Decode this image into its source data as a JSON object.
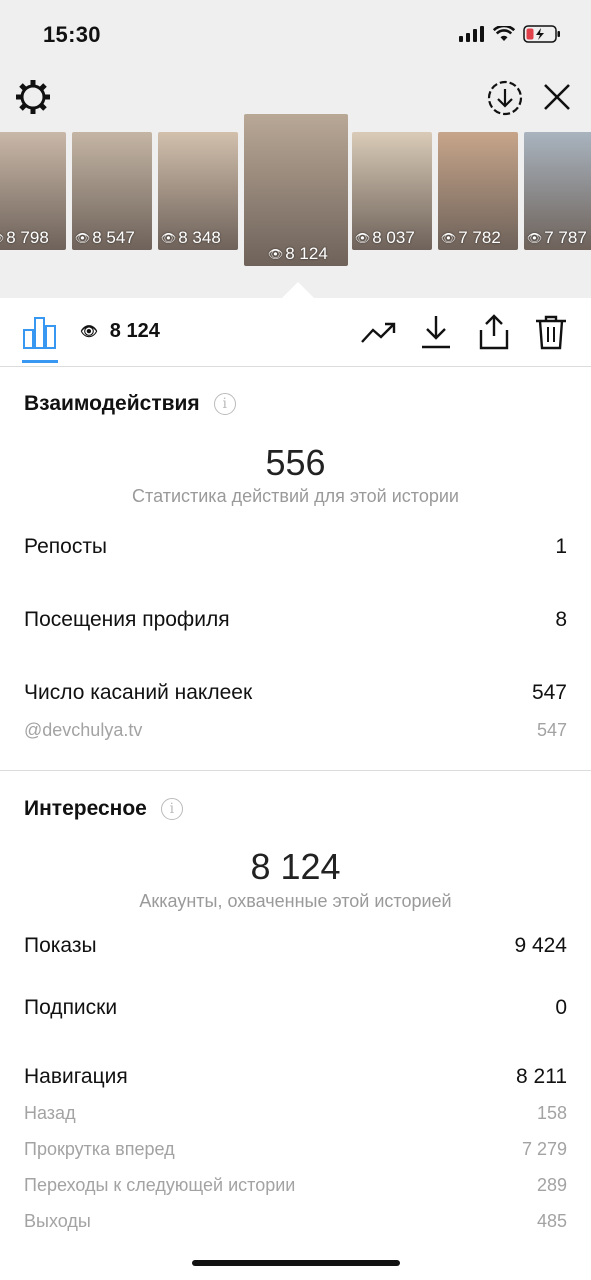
{
  "status": {
    "time": "15:30"
  },
  "thumbnails": [
    {
      "views": "8 798",
      "bg": "#c9b8a8"
    },
    {
      "views": "8 547",
      "bg": "#c4b5a4"
    },
    {
      "views": "8 348",
      "bg": "#d2c0ad"
    },
    {
      "views": "8 124",
      "bg": "#b9a896",
      "active": true
    },
    {
      "views": "8 037",
      "bg": "#d9cbb7"
    },
    {
      "views": "7 782",
      "bg": "#c7a58a"
    },
    {
      "views": "7 787",
      "bg": "#a9b4bf"
    }
  ],
  "toolbar": {
    "views": "8 124"
  },
  "interactions": {
    "title": "Взаимодействия",
    "total": "556",
    "subtitle": "Статистика действий для этой истории",
    "rows": [
      {
        "label": "Репосты",
        "value": "1"
      },
      {
        "label": "Посещения профиля",
        "value": "8"
      },
      {
        "label": "Число касаний наклеек",
        "value": "547"
      }
    ],
    "sub_rows": [
      {
        "label": "@devchulya.tv",
        "value": "547"
      }
    ]
  },
  "discovery": {
    "title": "Интересное",
    "total": "8 124",
    "subtitle": "Аккаунты, охваченные этой историей",
    "rows": [
      {
        "label": "Показы",
        "value": "9 424"
      },
      {
        "label": "Подписки",
        "value": "0"
      },
      {
        "label": "Навигация",
        "value": "8 211"
      }
    ],
    "nav_rows": [
      {
        "label": "Назад",
        "value": "158"
      },
      {
        "label": "Прокрутка вперед",
        "value": "7 279"
      },
      {
        "label": "Переходы к следующей истории",
        "value": "289"
      },
      {
        "label": "Выходы",
        "value": "485"
      }
    ]
  },
  "colors": {
    "accent": "#3897f0",
    "battery": "#e0414b"
  }
}
